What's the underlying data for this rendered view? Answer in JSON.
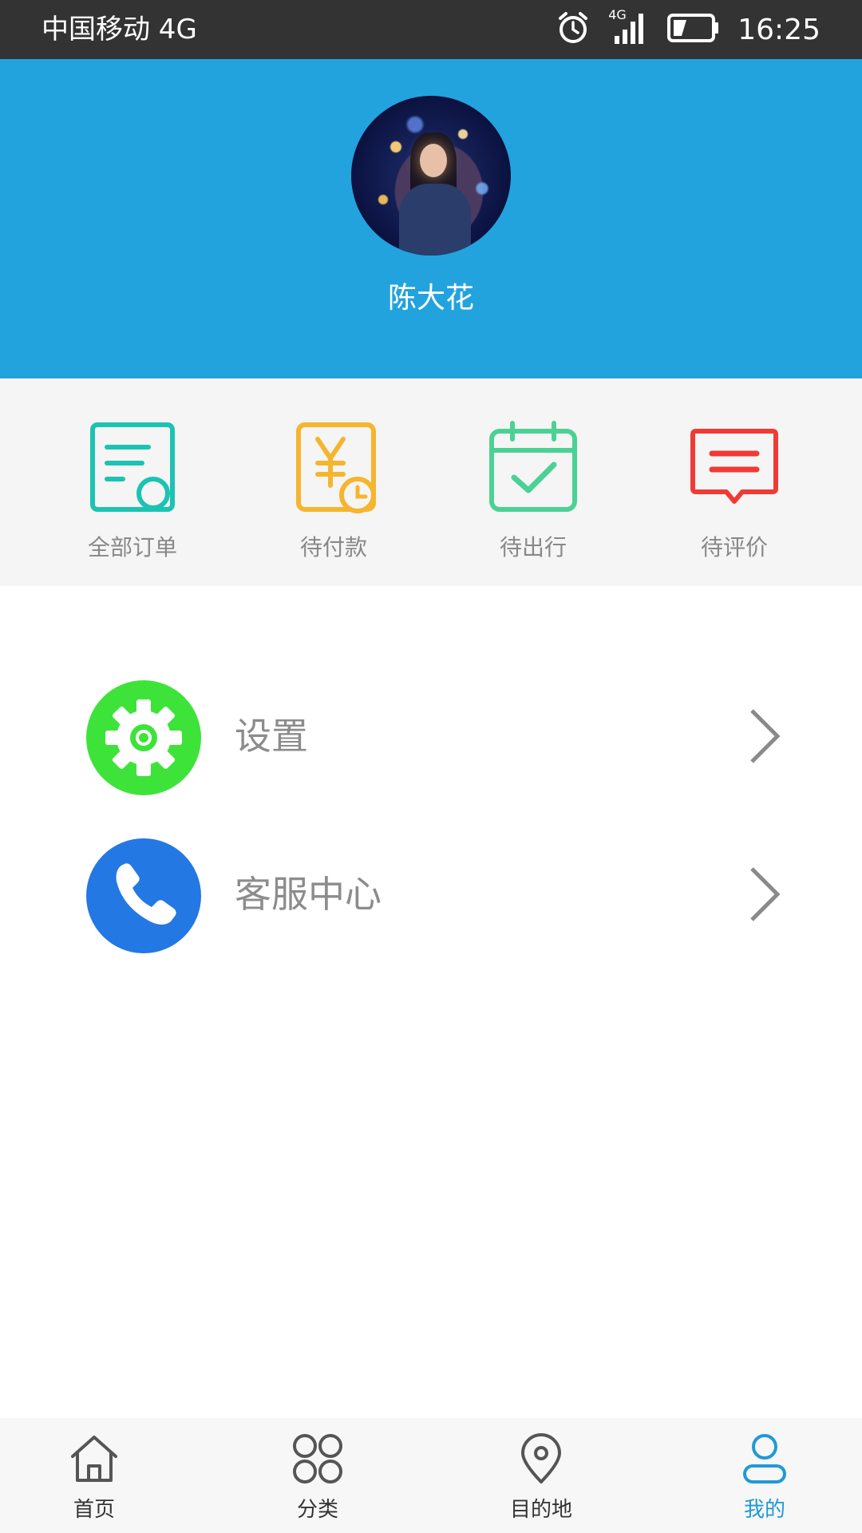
{
  "status_bar": {
    "carrier": "中国移动 4G",
    "network_tag": "4G",
    "time": "16:25",
    "icons": [
      "alarm-icon",
      "signal-icon",
      "battery-icon"
    ]
  },
  "profile": {
    "username": "陈大花",
    "header_color": "#22a3de"
  },
  "orders": [
    {
      "label": "全部订单",
      "icon": "order-list-icon",
      "color": "#1cc3b2"
    },
    {
      "label": "待付款",
      "icon": "pending-payment-icon",
      "color": "#f5b52e"
    },
    {
      "label": "待出行",
      "icon": "calendar-check-icon",
      "color": "#4cd195"
    },
    {
      "label": "待评价",
      "icon": "comment-icon",
      "color": "#f03a35"
    }
  ],
  "menu": [
    {
      "label": "设置",
      "icon": "gear-icon",
      "color": "#3ee33a"
    },
    {
      "label": "客服中心",
      "icon": "phone-icon",
      "color": "#2478e4"
    }
  ],
  "tabs": [
    {
      "label": "首页",
      "icon": "home-icon",
      "active": false
    },
    {
      "label": "分类",
      "icon": "category-icon",
      "active": false
    },
    {
      "label": "目的地",
      "icon": "location-pin-icon",
      "active": false
    },
    {
      "label": "我的",
      "icon": "user-icon",
      "active": true
    }
  ],
  "accent_color": "#1f9ad6"
}
